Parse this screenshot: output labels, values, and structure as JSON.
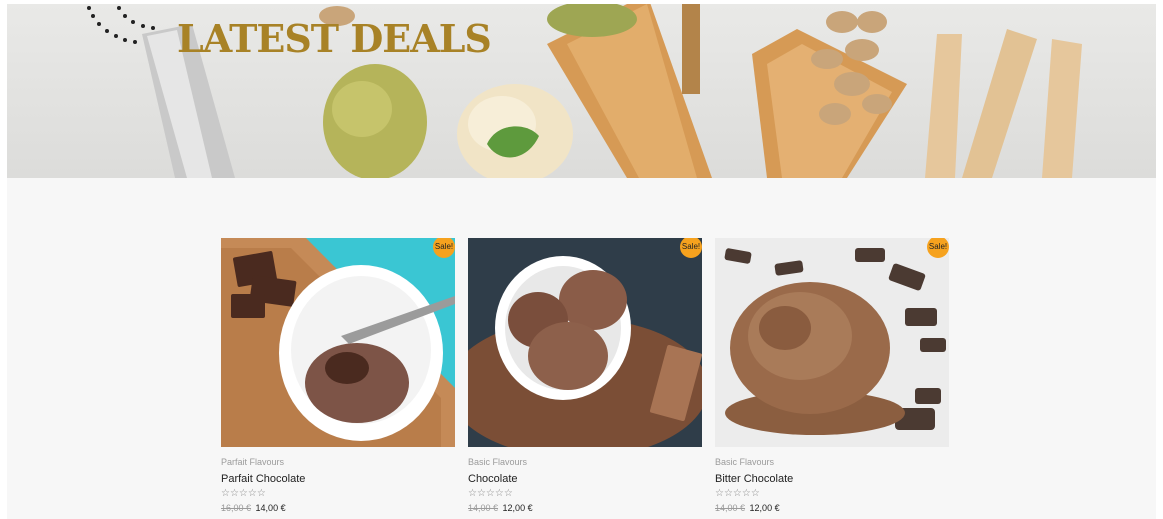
{
  "banner": {
    "title": "LATEST DEALS"
  },
  "products": [
    {
      "category": "Parfait Flavours",
      "title": "Parfait Chocolate",
      "badge": "Sale!",
      "rating": "☆☆☆☆☆",
      "old_price": "16,00 €",
      "price": "14,00 €"
    },
    {
      "category": "Basic Flavours",
      "title": "Chocolate",
      "badge": "Sale!",
      "rating": "☆☆☆☆☆",
      "old_price": "14,00 €",
      "price": "12,00 €"
    },
    {
      "category": "Basic Flavours",
      "title": "Bitter Chocolate",
      "badge": "Sale!",
      "rating": "☆☆☆☆☆",
      "old_price": "14,00 €",
      "price": "12,00 €"
    }
  ],
  "colors": {
    "title_gold": "#a88226",
    "sale_orange": "#f6a21e",
    "page_bg": "#f7f7f7"
  }
}
